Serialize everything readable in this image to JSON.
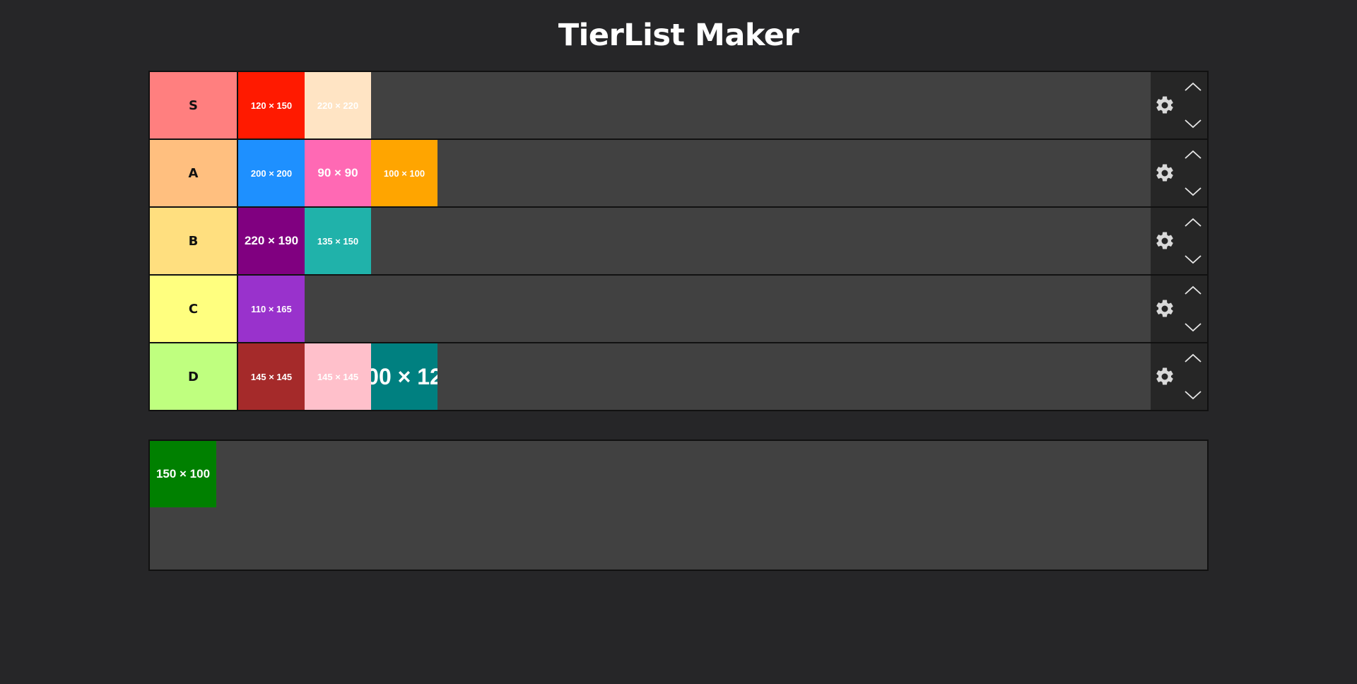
{
  "app": {
    "title": "TierList Maker"
  },
  "colors": {
    "background": "#262628",
    "row_background": "#414141",
    "controls_background": "#262626"
  },
  "icons": {
    "settings": "gear-icon",
    "move_up": "chevron-up-icon",
    "move_down": "chevron-down-icon"
  },
  "tiers": [
    {
      "label": "S",
      "color": "#ff7f7f",
      "items": [
        {
          "text": "120 × 150",
          "color": "#ff1a00"
        },
        {
          "text": "220 × 220",
          "color": "#ffe4c4"
        }
      ]
    },
    {
      "label": "A",
      "color": "#ffbf7f",
      "items": [
        {
          "text": "200 × 200",
          "color": "#1e90ff"
        },
        {
          "text": "90 × 90",
          "color": "#ff69b4"
        },
        {
          "text": "100 × 100",
          "color": "#ffa500"
        }
      ]
    },
    {
      "label": "B",
      "color": "#ffdf7f",
      "items": [
        {
          "text": "220 × 190",
          "color": "#800080"
        },
        {
          "text": "135 × 150",
          "color": "#20b2aa"
        }
      ]
    },
    {
      "label": "C",
      "color": "#ffff7f",
      "items": [
        {
          "text": "110 × 165",
          "color": "#9932cc"
        }
      ]
    },
    {
      "label": "D",
      "color": "#bfff7f",
      "items": [
        {
          "text": "145 × 145",
          "color": "#a52a2a"
        },
        {
          "text": "145 × 145",
          "color": "#ffc0cb"
        },
        {
          "text": "00 × 12",
          "color": "#008080"
        }
      ]
    }
  ],
  "pool": {
    "items": [
      {
        "text": "150 × 100",
        "color": "#008000"
      }
    ]
  }
}
